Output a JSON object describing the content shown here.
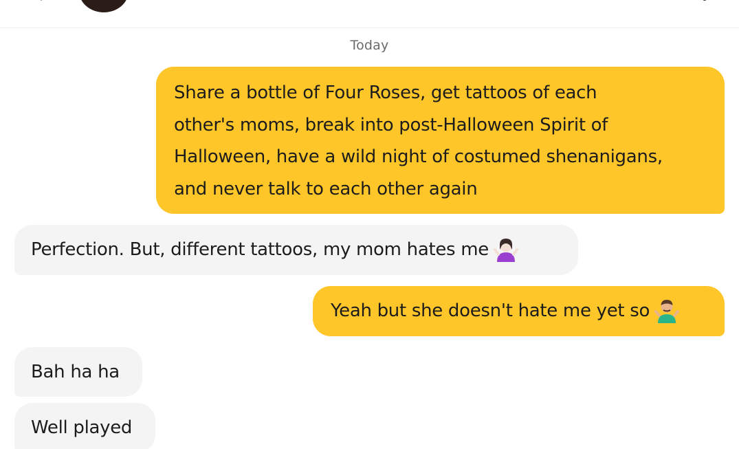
{
  "header": {
    "back_icon": "back-arrow-icon",
    "avatar": "contact-avatar",
    "more_icon": "more-options-icon"
  },
  "date_separator": "Today",
  "messages": [
    {
      "direction": "outgoing",
      "lines": [
        "Share a bottle of Four Roses, get tattoos of each",
        "other's moms, break into post-Halloween Spirit of",
        "Halloween, have a wild night of costumed shenanigans,",
        "and never talk to each other again"
      ]
    },
    {
      "direction": "incoming",
      "text": "Perfection. But, different tattoos, my mom hates me",
      "emoji": "woman-shrugging-emoji"
    },
    {
      "direction": "outgoing",
      "text": "Yeah but she doesn't hate me yet so",
      "emoji": "man-shrugging-emoji"
    },
    {
      "direction": "incoming",
      "text": "Bah ha ha"
    },
    {
      "direction": "incoming",
      "text": "Well played"
    }
  ],
  "colors": {
    "outgoing_bubble": "#ffc629",
    "incoming_bubble": "#f4f4f5",
    "text": "#1c1c1c",
    "date_text": "#6a6a6a"
  }
}
